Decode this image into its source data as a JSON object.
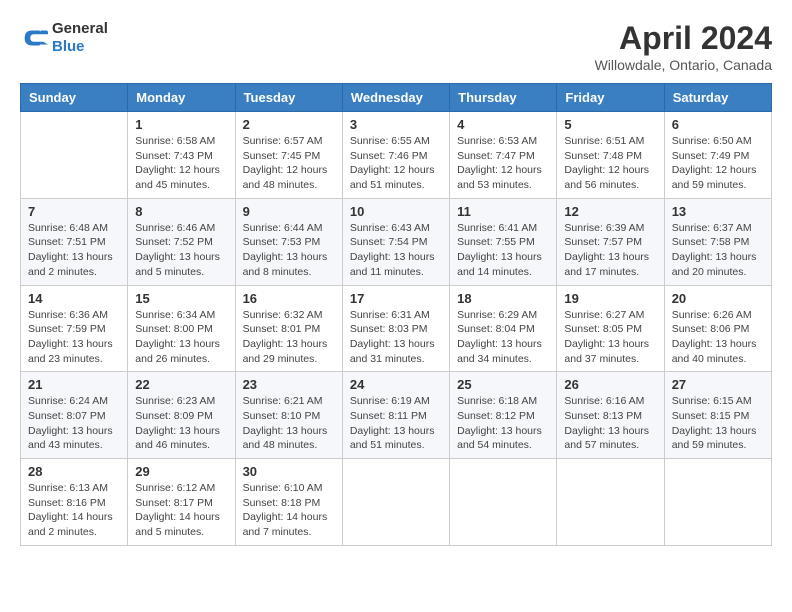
{
  "header": {
    "logo_general": "General",
    "logo_blue": "Blue",
    "month_title": "April 2024",
    "location": "Willowdale, Ontario, Canada"
  },
  "days_of_week": [
    "Sunday",
    "Monday",
    "Tuesday",
    "Wednesday",
    "Thursday",
    "Friday",
    "Saturday"
  ],
  "weeks": [
    [
      {
        "day": "",
        "info": ""
      },
      {
        "day": "1",
        "info": "Sunrise: 6:58 AM\nSunset: 7:43 PM\nDaylight: 12 hours\nand 45 minutes."
      },
      {
        "day": "2",
        "info": "Sunrise: 6:57 AM\nSunset: 7:45 PM\nDaylight: 12 hours\nand 48 minutes."
      },
      {
        "day": "3",
        "info": "Sunrise: 6:55 AM\nSunset: 7:46 PM\nDaylight: 12 hours\nand 51 minutes."
      },
      {
        "day": "4",
        "info": "Sunrise: 6:53 AM\nSunset: 7:47 PM\nDaylight: 12 hours\nand 53 minutes."
      },
      {
        "day": "5",
        "info": "Sunrise: 6:51 AM\nSunset: 7:48 PM\nDaylight: 12 hours\nand 56 minutes."
      },
      {
        "day": "6",
        "info": "Sunrise: 6:50 AM\nSunset: 7:49 PM\nDaylight: 12 hours\nand 59 minutes."
      }
    ],
    [
      {
        "day": "7",
        "info": "Sunrise: 6:48 AM\nSunset: 7:51 PM\nDaylight: 13 hours\nand 2 minutes."
      },
      {
        "day": "8",
        "info": "Sunrise: 6:46 AM\nSunset: 7:52 PM\nDaylight: 13 hours\nand 5 minutes."
      },
      {
        "day": "9",
        "info": "Sunrise: 6:44 AM\nSunset: 7:53 PM\nDaylight: 13 hours\nand 8 minutes."
      },
      {
        "day": "10",
        "info": "Sunrise: 6:43 AM\nSunset: 7:54 PM\nDaylight: 13 hours\nand 11 minutes."
      },
      {
        "day": "11",
        "info": "Sunrise: 6:41 AM\nSunset: 7:55 PM\nDaylight: 13 hours\nand 14 minutes."
      },
      {
        "day": "12",
        "info": "Sunrise: 6:39 AM\nSunset: 7:57 PM\nDaylight: 13 hours\nand 17 minutes."
      },
      {
        "day": "13",
        "info": "Sunrise: 6:37 AM\nSunset: 7:58 PM\nDaylight: 13 hours\nand 20 minutes."
      }
    ],
    [
      {
        "day": "14",
        "info": "Sunrise: 6:36 AM\nSunset: 7:59 PM\nDaylight: 13 hours\nand 23 minutes."
      },
      {
        "day": "15",
        "info": "Sunrise: 6:34 AM\nSunset: 8:00 PM\nDaylight: 13 hours\nand 26 minutes."
      },
      {
        "day": "16",
        "info": "Sunrise: 6:32 AM\nSunset: 8:01 PM\nDaylight: 13 hours\nand 29 minutes."
      },
      {
        "day": "17",
        "info": "Sunrise: 6:31 AM\nSunset: 8:03 PM\nDaylight: 13 hours\nand 31 minutes."
      },
      {
        "day": "18",
        "info": "Sunrise: 6:29 AM\nSunset: 8:04 PM\nDaylight: 13 hours\nand 34 minutes."
      },
      {
        "day": "19",
        "info": "Sunrise: 6:27 AM\nSunset: 8:05 PM\nDaylight: 13 hours\nand 37 minutes."
      },
      {
        "day": "20",
        "info": "Sunrise: 6:26 AM\nSunset: 8:06 PM\nDaylight: 13 hours\nand 40 minutes."
      }
    ],
    [
      {
        "day": "21",
        "info": "Sunrise: 6:24 AM\nSunset: 8:07 PM\nDaylight: 13 hours\nand 43 minutes."
      },
      {
        "day": "22",
        "info": "Sunrise: 6:23 AM\nSunset: 8:09 PM\nDaylight: 13 hours\nand 46 minutes."
      },
      {
        "day": "23",
        "info": "Sunrise: 6:21 AM\nSunset: 8:10 PM\nDaylight: 13 hours\nand 48 minutes."
      },
      {
        "day": "24",
        "info": "Sunrise: 6:19 AM\nSunset: 8:11 PM\nDaylight: 13 hours\nand 51 minutes."
      },
      {
        "day": "25",
        "info": "Sunrise: 6:18 AM\nSunset: 8:12 PM\nDaylight: 13 hours\nand 54 minutes."
      },
      {
        "day": "26",
        "info": "Sunrise: 6:16 AM\nSunset: 8:13 PM\nDaylight: 13 hours\nand 57 minutes."
      },
      {
        "day": "27",
        "info": "Sunrise: 6:15 AM\nSunset: 8:15 PM\nDaylight: 13 hours\nand 59 minutes."
      }
    ],
    [
      {
        "day": "28",
        "info": "Sunrise: 6:13 AM\nSunset: 8:16 PM\nDaylight: 14 hours\nand 2 minutes."
      },
      {
        "day": "29",
        "info": "Sunrise: 6:12 AM\nSunset: 8:17 PM\nDaylight: 14 hours\nand 5 minutes."
      },
      {
        "day": "30",
        "info": "Sunrise: 6:10 AM\nSunset: 8:18 PM\nDaylight: 14 hours\nand 7 minutes."
      },
      {
        "day": "",
        "info": ""
      },
      {
        "day": "",
        "info": ""
      },
      {
        "day": "",
        "info": ""
      },
      {
        "day": "",
        "info": ""
      }
    ]
  ]
}
